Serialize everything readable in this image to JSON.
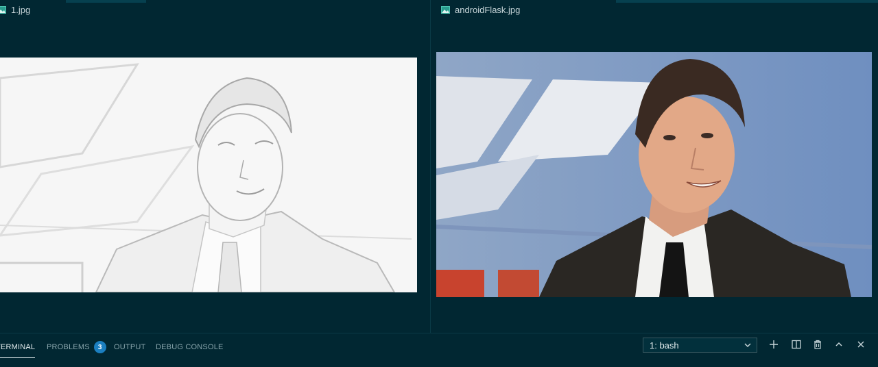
{
  "editor": {
    "left_tab": {
      "label": "1.jpg",
      "icon": "image-file-icon"
    },
    "right_tab": {
      "label": "androidFlask.jpg",
      "icon": "image-file-icon"
    }
  },
  "panel": {
    "tabs": [
      {
        "label": "TERMINAL",
        "active": true
      },
      {
        "label": "PROBLEMS",
        "badge": "3"
      },
      {
        "label": "OUTPUT"
      },
      {
        "label": "DEBUG CONSOLE"
      }
    ],
    "terminal_select": {
      "value": "1: bash"
    },
    "actions": [
      "plus-icon",
      "split-icon",
      "trash-icon",
      "chevron-up-icon",
      "close-icon"
    ]
  },
  "colors": {
    "background": "#012732",
    "badge": "#1b7fc0",
    "accent_text": "#e4edef"
  }
}
